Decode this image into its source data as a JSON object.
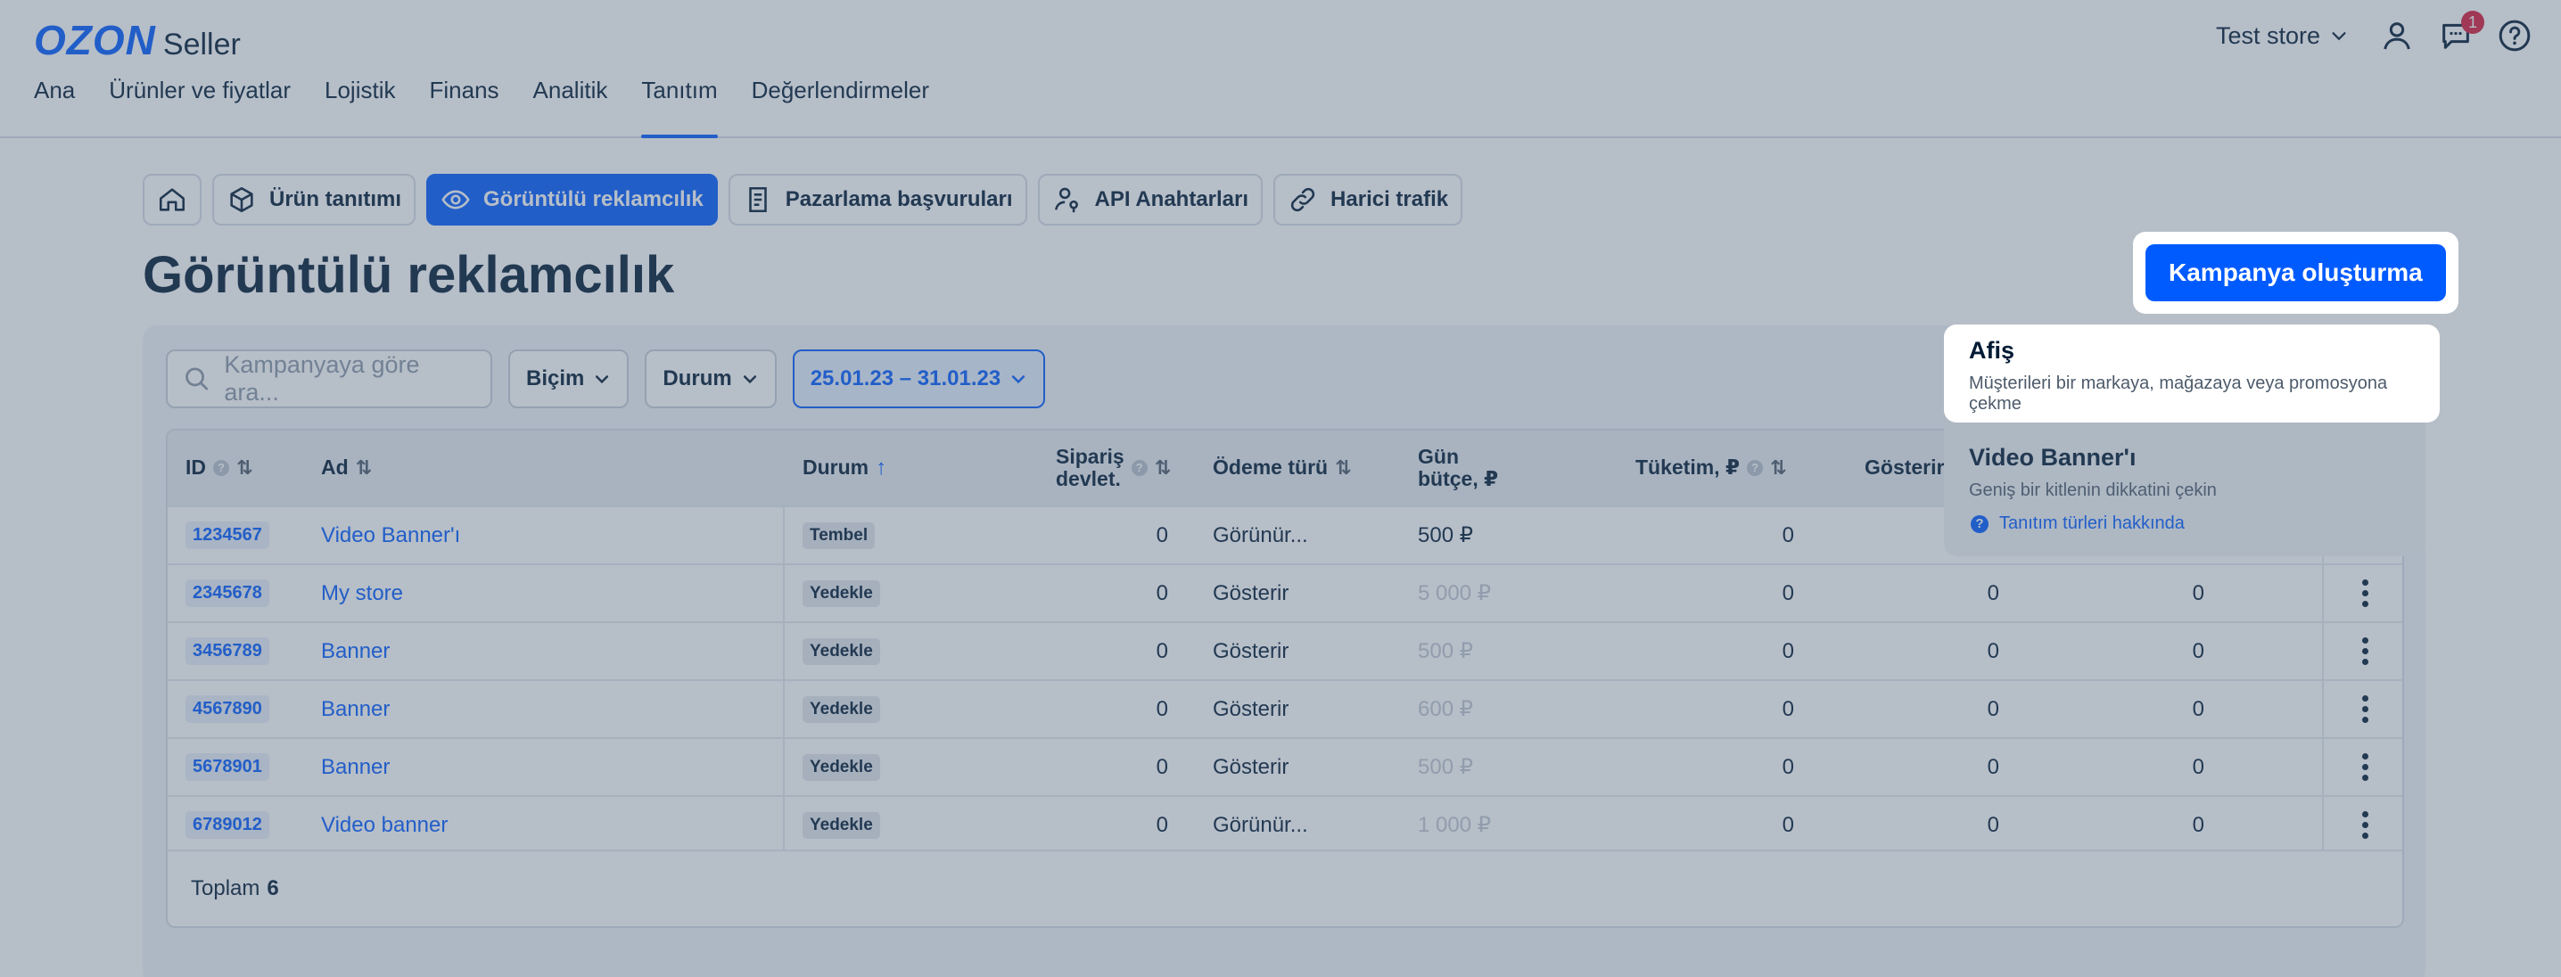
{
  "header": {
    "logo_main": "OZON",
    "logo_sub": "Seller",
    "store": "Test store",
    "notifications": "1"
  },
  "nav": [
    "Ana",
    "Ürünler ve fiyatlar",
    "Lojistik",
    "Finans",
    "Analitik",
    "Tanıtım",
    "Değerlendirmeler"
  ],
  "nav_active": "Tanıtım",
  "subnav": {
    "product_promo": "Ürün tanıtımı",
    "display_ads": "Görüntülü reklamcılık",
    "marketing": "Pazarlama başvuruları",
    "api_keys": "API Anahtarları",
    "external": "Harici trafik"
  },
  "page_title": "Görüntülü reklamcılık",
  "create_button": "Kampanya oluşturma",
  "filters": {
    "search_placeholder": "Kampanyaya göre ara...",
    "format": "Biçim",
    "status": "Durum",
    "date_range": "25.01.23 – 31.01.23"
  },
  "table": {
    "headers": {
      "id": "ID",
      "name": "Ad",
      "status": "Durum",
      "orders_line1": "Sipariş",
      "orders_line2": "devlet.",
      "payment": "Ödeme türü",
      "budget_line1": "Gün",
      "budget_line2": "bütçe, ₽",
      "spend": "Tüketim, ₽",
      "shows": "Gösterir"
    },
    "rows": [
      {
        "id": "1234567",
        "name": "Video Banner'ı",
        "status": "Tembel",
        "orders": "0",
        "payment": "Görünür...",
        "budget": "500 ₽",
        "budget_muted": false,
        "spend": "0",
        "shows": "",
        "clicks": ""
      },
      {
        "id": "2345678",
        "name": "My store",
        "status": "Yedekle",
        "orders": "0",
        "payment": "Gösterir",
        "budget": "5 000 ₽",
        "budget_muted": true,
        "spend": "0",
        "shows": "0",
        "clicks": "0"
      },
      {
        "id": "3456789",
        "name": "Banner",
        "status": "Yedekle",
        "orders": "0",
        "payment": "Gösterir",
        "budget": "500 ₽",
        "budget_muted": true,
        "spend": "0",
        "shows": "0",
        "clicks": "0"
      },
      {
        "id": "4567890",
        "name": "Banner",
        "status": "Yedekle",
        "orders": "0",
        "payment": "Gösterir",
        "budget": "600 ₽",
        "budget_muted": true,
        "spend": "0",
        "shows": "0",
        "clicks": "0"
      },
      {
        "id": "5678901",
        "name": "Banner",
        "status": "Yedekle",
        "orders": "0",
        "payment": "Gösterir",
        "budget": "500 ₽",
        "budget_muted": true,
        "spend": "0",
        "shows": "0",
        "clicks": "0"
      },
      {
        "id": "6789012",
        "name": "Video banner",
        "status": "Yedekle",
        "orders": "0",
        "payment": "Görünür...",
        "budget": "1 000 ₽",
        "budget_muted": true,
        "spend": "0",
        "shows": "0",
        "clicks": "0"
      }
    ],
    "total_label": "Toplam",
    "total_value": "6"
  },
  "dropdown": {
    "poster_title": "Afiş",
    "poster_desc": "Müşterileri bir markaya, mağazaya veya promosyona çekme",
    "video_title": "Video Banner'ı",
    "video_desc": "Geniş bir kitlenin dikkatini çekin",
    "help": "Tanıtım türleri hakkında"
  },
  "colors": {
    "accent": "#005bff",
    "text": "#001a34",
    "badge_red": "#d81b3c"
  }
}
